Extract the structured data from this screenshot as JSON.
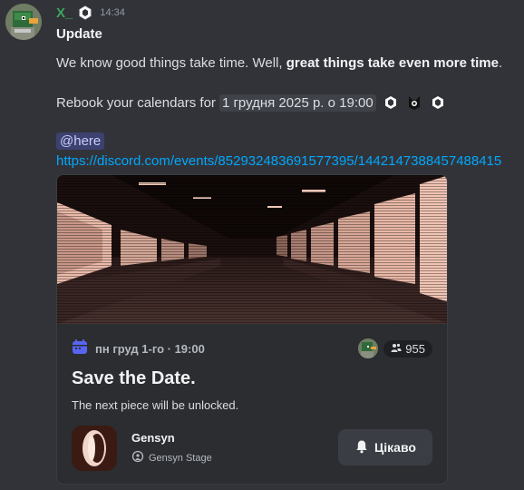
{
  "author": {
    "username": "X_",
    "timestamp": "14:34"
  },
  "message": {
    "title": "Update",
    "line1_plain": "We know good things take time. Well, ",
    "line1_bold": "great things take even more time",
    "line1_end": ".",
    "line2_prefix": "Rebook your calendars for",
    "line2_date": "1 грудня 2025 р. о 19:00",
    "mention": "@here",
    "link": "https://discord.com/events/852932483691577395/1442147388457488415"
  },
  "event": {
    "datetime": "пн груд 1-го · 19:00",
    "interested_count": "955",
    "title": "Save the Date.",
    "description": "The next piece will be unlocked.",
    "guild_name": "Gensyn",
    "stage_name": "Gensyn Stage",
    "interested_label": "Цікаво"
  },
  "colors": {
    "background": "#323339",
    "username": "#3ba55d",
    "link": "#00a8fc",
    "accent": "#5865f2",
    "card": "#2b2d31"
  },
  "icons": [
    "duck-avatar-icon",
    "hexagon-badge-icon",
    "calendar-icon",
    "people-icon",
    "stage-icon",
    "bell-icon",
    "cat-emoji-icon"
  ]
}
